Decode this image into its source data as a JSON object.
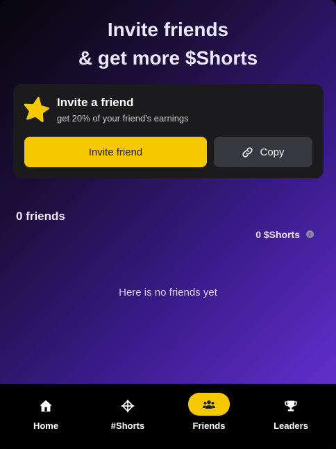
{
  "header": {
    "line1": "Invite friends",
    "line2": "& get more $Shorts"
  },
  "invite_card": {
    "icon": "star-icon",
    "title": "Invite a friend",
    "subtitle": "get 20% of your friend's earnings",
    "invite_button": "Invite friend",
    "copy_button": "Copy",
    "copy_icon": "link-icon"
  },
  "friends": {
    "count_label": "0 friends",
    "shorts_total": "0 $Shorts",
    "empty_text": "Here is no friends yet"
  },
  "nav": {
    "items": [
      {
        "label": "Home",
        "icon": "home-icon",
        "active": false
      },
      {
        "label": "#Shorts",
        "icon": "crosshair-icon",
        "active": false
      },
      {
        "label": "Friends",
        "icon": "users-icon",
        "active": true
      },
      {
        "label": "Leaders",
        "icon": "trophy-icon",
        "active": false
      }
    ]
  },
  "colors": {
    "accent": "#f5c800",
    "card_bg": "#1b1b1d",
    "copy_bg": "#37383d",
    "gradient_end": "#6b34dc"
  }
}
